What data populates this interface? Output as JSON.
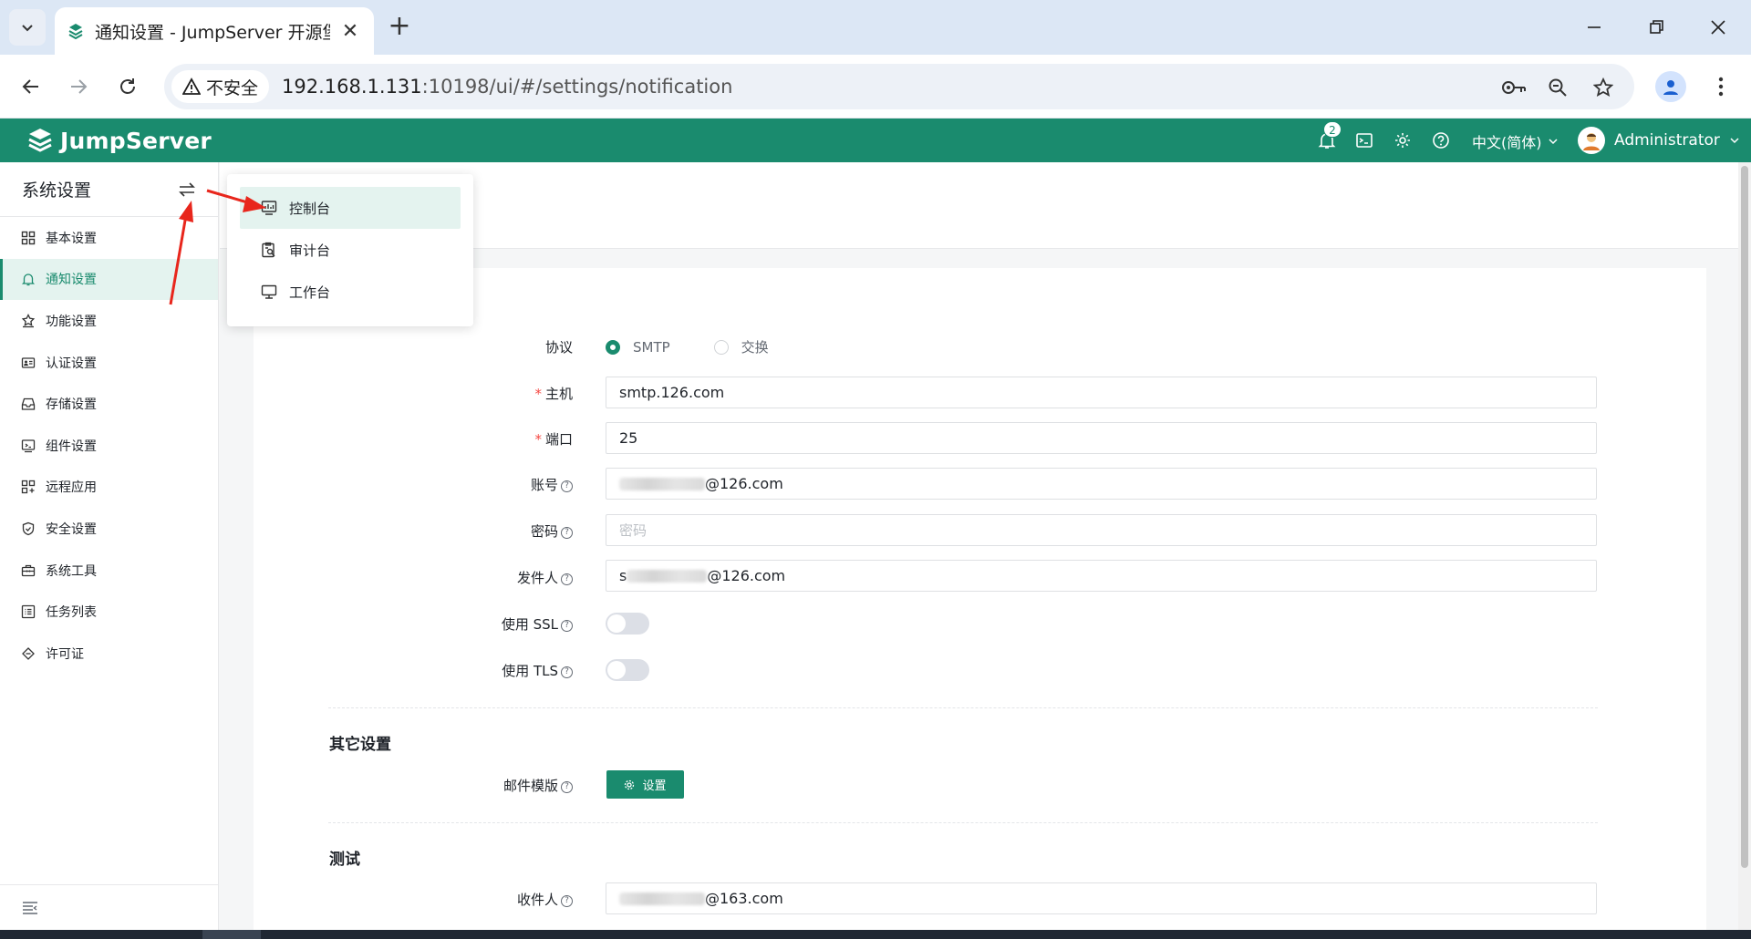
{
  "browser": {
    "tab_title": "通知设置 - JumpServer 开源堡垒机",
    "tab_close": "✕",
    "new_tab": "+",
    "security_label": "不安全",
    "url_host": "192.168.1.131",
    "url_rest": ":10198/ui/#/settings/notification"
  },
  "app": {
    "logo": "JumpServer",
    "notification_count": "2",
    "language": "中文(简体)",
    "user": "Administrator"
  },
  "sidebar": {
    "title": "系统设置",
    "items": [
      {
        "label": "基本设置",
        "icon": "grid-icon"
      },
      {
        "label": "通知设置",
        "icon": "bell-icon",
        "active": true
      },
      {
        "label": "功能设置",
        "icon": "star-box-icon"
      },
      {
        "label": "认证设置",
        "icon": "id-card-icon"
      },
      {
        "label": "存储设置",
        "icon": "inbox-icon"
      },
      {
        "label": "组件设置",
        "icon": "component-icon"
      },
      {
        "label": "远程应用",
        "icon": "apps-icon"
      },
      {
        "label": "安全设置",
        "icon": "shield-icon"
      },
      {
        "label": "系统工具",
        "icon": "toolbox-icon"
      },
      {
        "label": "任务列表",
        "icon": "list-icon"
      },
      {
        "label": "许可证",
        "icon": "license-icon"
      }
    ]
  },
  "view_switcher": {
    "items": [
      {
        "label": "控制台",
        "icon": "dashboard-icon",
        "active": true
      },
      {
        "label": "审计台",
        "icon": "audit-icon"
      },
      {
        "label": "工作台",
        "icon": "monitor-icon"
      }
    ]
  },
  "form": {
    "protocol_label": "协议",
    "protocol_options": [
      "SMTP",
      "交换"
    ],
    "protocol_selected": "SMTP",
    "host_label": "主机",
    "host_value": "smtp.126.com",
    "port_label": "端口",
    "port_value": "25",
    "account_label": "账号",
    "account_suffix": "@126.com",
    "password_label": "密码",
    "password_placeholder": "密码",
    "sender_label": "发件人",
    "sender_prefix": "s",
    "sender_suffix": "@126.com",
    "ssl_label": "使用 SSL",
    "ssl_on": false,
    "tls_label": "使用 TLS",
    "tls_on": false,
    "other_section": "其它设置",
    "template_label": "邮件模版",
    "template_button": "设置",
    "test_section": "测试",
    "recipient_label": "收件人",
    "recipient_suffix": "@163.com"
  },
  "colors": {
    "brand": "#1a8b6e",
    "active_bg": "#e4f3ef",
    "required": "#f54a45",
    "arrow": "#e8261c"
  }
}
